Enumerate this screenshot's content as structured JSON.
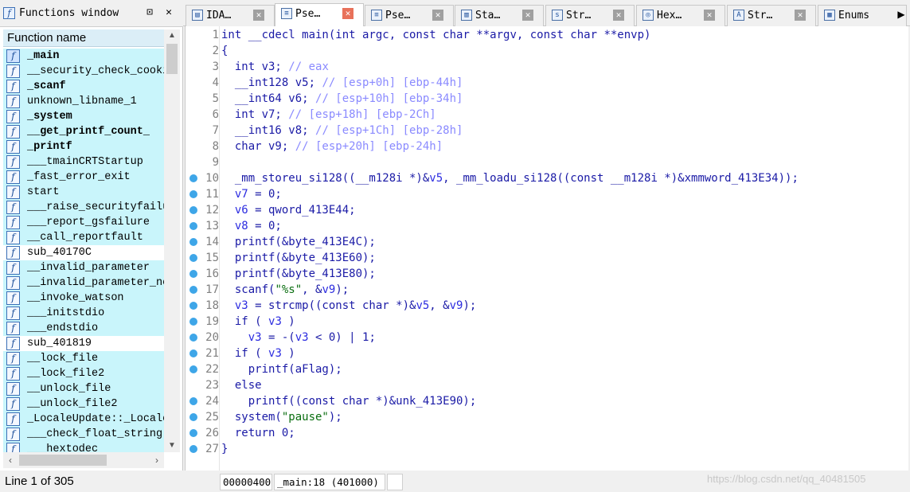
{
  "functions_window": {
    "title": "Functions window",
    "pin_glyph": "⊡",
    "close_glyph": "✕",
    "column_header": "Function name",
    "status": "Line 1 of 305",
    "items": [
      {
        "name": "_main",
        "bold": true,
        "kind": "sel"
      },
      {
        "name": "__security_check_cooki",
        "bold": false,
        "kind": "lib"
      },
      {
        "name": "_scanf",
        "bold": true,
        "kind": "lib"
      },
      {
        "name": "unknown_libname_1",
        "bold": false,
        "kind": "lib"
      },
      {
        "name": "_system",
        "bold": true,
        "kind": "lib"
      },
      {
        "name": "__get_printf_count_",
        "bold": true,
        "kind": "lib"
      },
      {
        "name": "_printf",
        "bold": true,
        "kind": "lib"
      },
      {
        "name": "___tmainCRTStartup",
        "bold": false,
        "kind": "lib"
      },
      {
        "name": "_fast_error_exit",
        "bold": false,
        "kind": "lib"
      },
      {
        "name": "start",
        "bold": false,
        "kind": "lib"
      },
      {
        "name": "___raise_securityfailu",
        "bold": false,
        "kind": "lib"
      },
      {
        "name": "___report_gsfailure",
        "bold": false,
        "kind": "lib"
      },
      {
        "name": "__call_reportfault",
        "bold": false,
        "kind": "lib"
      },
      {
        "name": "sub_40170C",
        "bold": false,
        "kind": "reg"
      },
      {
        "name": "__invalid_parameter",
        "bold": false,
        "kind": "lib"
      },
      {
        "name": "__invalid_parameter_nc",
        "bold": false,
        "kind": "lib"
      },
      {
        "name": "__invoke_watson",
        "bold": false,
        "kind": "lib"
      },
      {
        "name": "___initstdio",
        "bold": false,
        "kind": "lib"
      },
      {
        "name": "___endstdio",
        "bold": false,
        "kind": "lib"
      },
      {
        "name": "sub_401819",
        "bold": false,
        "kind": "reg"
      },
      {
        "name": "__lock_file",
        "bold": false,
        "kind": "lib"
      },
      {
        "name": "__lock_file2",
        "bold": false,
        "kind": "lib"
      },
      {
        "name": "__unlock_file",
        "bold": false,
        "kind": "lib"
      },
      {
        "name": "__unlock_file2",
        "bold": false,
        "kind": "lib"
      },
      {
        "name": "_LocaleUpdate::_Locale",
        "bold": false,
        "kind": "lib"
      },
      {
        "name": "___check_float_string",
        "bold": false,
        "kind": "lib"
      },
      {
        "name": "___hextodec",
        "bold": false,
        "kind": "lib"
      }
    ]
  },
  "tabs": [
    {
      "label": "IDA…",
      "icon": "ida-view-icon",
      "glyph": "▤",
      "active": false
    },
    {
      "label": "Pse…",
      "icon": "pseudocode-icon",
      "glyph": "≡",
      "active": true
    },
    {
      "label": "Pse…",
      "icon": "pseudocode-icon",
      "glyph": "≡",
      "active": false
    },
    {
      "label": "Sta…",
      "icon": "stack-icon",
      "glyph": "▥",
      "active": false
    },
    {
      "label": "Str…",
      "icon": "strings-icon",
      "glyph": "s",
      "active": false
    },
    {
      "label": "Hex…",
      "icon": "hex-view-icon",
      "glyph": "◎",
      "active": false
    },
    {
      "label": "Str…",
      "icon": "structures-icon",
      "glyph": "A",
      "active": false
    },
    {
      "label": "Enums",
      "icon": "enums-icon",
      "glyph": "▦",
      "active": false
    }
  ],
  "tab_close_glyph": "✕",
  "tab_scroll_glyph": "▶",
  "code": {
    "lines": [
      {
        "no": "1",
        "dot": false,
        "parts": [
          [
            "k",
            "int "
          ],
          [
            "k",
            "__cdecl main(int argc, const char **argv, const char **envp)"
          ]
        ]
      },
      {
        "no": "2",
        "dot": false,
        "parts": [
          [
            "k",
            "{"
          ]
        ]
      },
      {
        "no": "3",
        "dot": false,
        "parts": [
          [
            "k",
            "  int v3; "
          ],
          [
            "c",
            "// eax"
          ]
        ]
      },
      {
        "no": "4",
        "dot": false,
        "parts": [
          [
            "k",
            "  __int128 v5; "
          ],
          [
            "c",
            "// [esp+0h] [ebp-44h]"
          ]
        ]
      },
      {
        "no": "5",
        "dot": false,
        "parts": [
          [
            "k",
            "  __int64 v6; "
          ],
          [
            "c",
            "// [esp+10h] [ebp-34h]"
          ]
        ]
      },
      {
        "no": "6",
        "dot": false,
        "parts": [
          [
            "k",
            "  int v7; "
          ],
          [
            "c",
            "// [esp+18h] [ebp-2Ch]"
          ]
        ]
      },
      {
        "no": "7",
        "dot": false,
        "parts": [
          [
            "k",
            "  __int16 v8; "
          ],
          [
            "c",
            "// [esp+1Ch] [ebp-28h]"
          ]
        ]
      },
      {
        "no": "8",
        "dot": false,
        "parts": [
          [
            "k",
            "  char v9; "
          ],
          [
            "c",
            "// [esp+20h] [ebp-24h]"
          ]
        ]
      },
      {
        "no": "9",
        "dot": false,
        "parts": []
      },
      {
        "no": "10",
        "dot": true,
        "parts": [
          [
            "k",
            "  _mm_storeu_si128((__m128i *)&"
          ],
          [
            "v",
            "v5"
          ],
          [
            "k",
            ", _mm_loadu_si128((const __m128i *)&xmmword_413E34));"
          ]
        ]
      },
      {
        "no": "11",
        "dot": true,
        "parts": [
          [
            "v",
            "  v7"
          ],
          [
            "k",
            " = 0;"
          ]
        ]
      },
      {
        "no": "12",
        "dot": true,
        "parts": [
          [
            "v",
            "  v6"
          ],
          [
            "k",
            " = qword_413E44;"
          ]
        ]
      },
      {
        "no": "13",
        "dot": true,
        "parts": [
          [
            "v",
            "  v8"
          ],
          [
            "k",
            " = 0;"
          ]
        ]
      },
      {
        "no": "14",
        "dot": true,
        "parts": [
          [
            "k",
            "  printf(&byte_413E4C);"
          ]
        ]
      },
      {
        "no": "15",
        "dot": true,
        "parts": [
          [
            "k",
            "  printf(&byte_413E60);"
          ]
        ]
      },
      {
        "no": "16",
        "dot": true,
        "parts": [
          [
            "k",
            "  printf(&byte_413E80);"
          ]
        ]
      },
      {
        "no": "17",
        "dot": true,
        "parts": [
          [
            "k",
            "  scanf("
          ],
          [
            "s",
            "\"%s\""
          ],
          [
            "k",
            ", &"
          ],
          [
            "v",
            "v9"
          ],
          [
            "k",
            ");"
          ]
        ]
      },
      {
        "no": "18",
        "dot": true,
        "parts": [
          [
            "v",
            "  v3"
          ],
          [
            "k",
            " = strcmp((const char *)&"
          ],
          [
            "v",
            "v5"
          ],
          [
            "k",
            ", &"
          ],
          [
            "v",
            "v9"
          ],
          [
            "k",
            ");"
          ]
        ]
      },
      {
        "no": "19",
        "dot": true,
        "parts": [
          [
            "k",
            "  if ( "
          ],
          [
            "v",
            "v3"
          ],
          [
            "k",
            " )"
          ]
        ]
      },
      {
        "no": "20",
        "dot": true,
        "parts": [
          [
            "v",
            "    v3"
          ],
          [
            "k",
            " = -("
          ],
          [
            "v",
            "v3"
          ],
          [
            "k",
            " < 0) | 1;"
          ]
        ]
      },
      {
        "no": "21",
        "dot": true,
        "parts": [
          [
            "k",
            "  if ( "
          ],
          [
            "v",
            "v3"
          ],
          [
            "k",
            " )"
          ]
        ]
      },
      {
        "no": "22",
        "dot": true,
        "parts": [
          [
            "k",
            "    printf(aFlag);"
          ]
        ]
      },
      {
        "no": "23",
        "dot": false,
        "parts": [
          [
            "k",
            "  else"
          ]
        ]
      },
      {
        "no": "24",
        "dot": true,
        "parts": [
          [
            "k",
            "    printf((const char *)&unk_413E90);"
          ]
        ]
      },
      {
        "no": "25",
        "dot": true,
        "parts": [
          [
            "k",
            "  system("
          ],
          [
            "s",
            "\"pause\""
          ],
          [
            "k",
            ");"
          ]
        ]
      },
      {
        "no": "26",
        "dot": true,
        "parts": [
          [
            "k",
            "  return 0;"
          ]
        ]
      },
      {
        "no": "27",
        "dot": true,
        "parts": [
          [
            "k",
            "}"
          ]
        ]
      }
    ]
  },
  "code_status": {
    "address": "00000400",
    "location": "_main:18 (401000)"
  },
  "watermark": "https://blog.csdn.net/qq_40481505"
}
